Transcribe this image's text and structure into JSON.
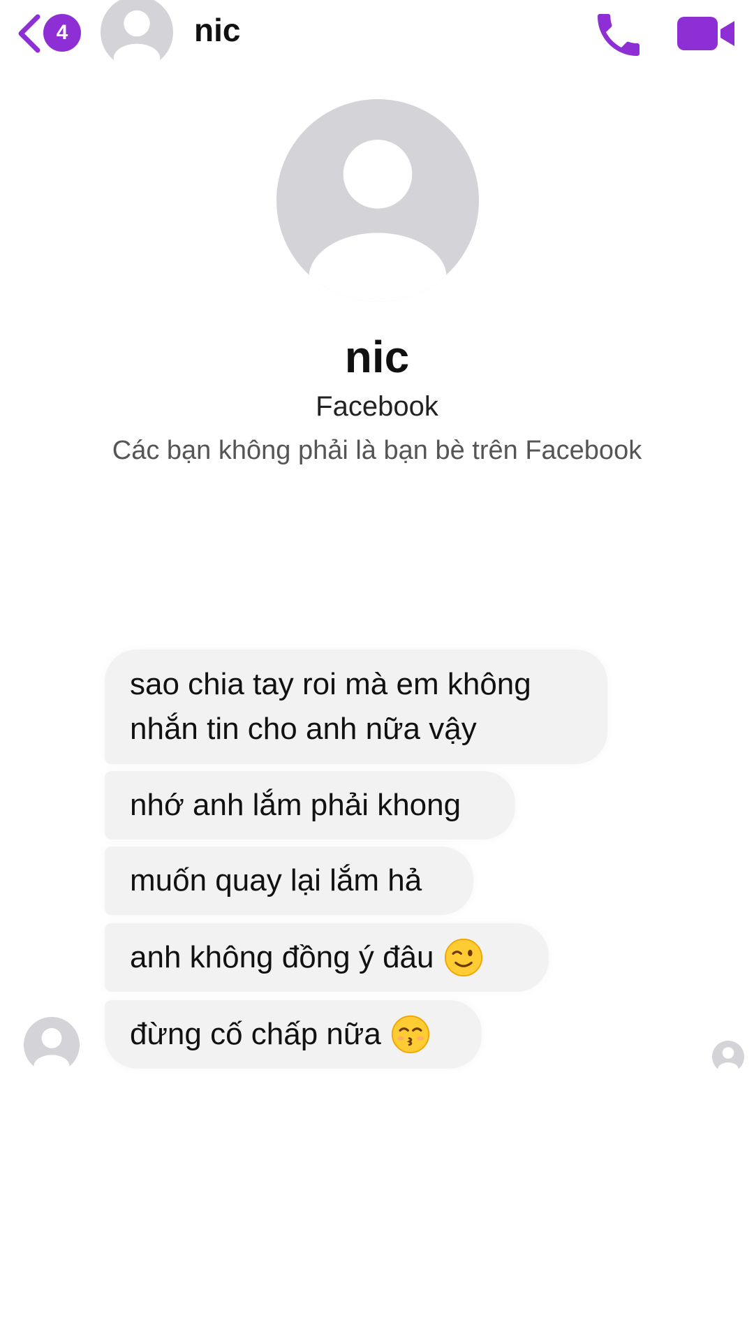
{
  "header": {
    "unread_count": "4",
    "contact_name": "nic"
  },
  "profile": {
    "name": "nic",
    "platform": "Facebook",
    "relation_note": "Các bạn không phải là bạn bè trên Facebook"
  },
  "messages": [
    {
      "lines": [
        "sao chia tay roi mà em không",
        "nhắn tin cho anh nữa vậy"
      ],
      "emoji": ""
    },
    {
      "text": "nhớ anh lắm phải khong",
      "emoji": ""
    },
    {
      "text": "muốn quay lại lắm hả",
      "emoji": ""
    },
    {
      "text": "anh không đồng ý đâu",
      "emoji": "winking-face"
    },
    {
      "text": "đừng cố chấp nữa",
      "emoji": "kissing-face-smiling-eyes"
    }
  ],
  "icons": {
    "back": "chevron-left-icon",
    "call": "phone-icon",
    "video": "video-camera-icon",
    "avatar": "default-avatar-icon"
  },
  "colors": {
    "accent": "#8e2fd6",
    "bubble": "#f2f2f3",
    "avatar_bg": "#d3d3d8"
  }
}
